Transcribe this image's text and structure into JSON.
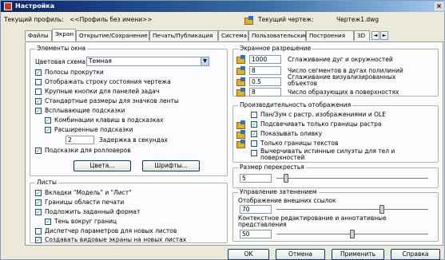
{
  "window": {
    "title": "Настройка"
  },
  "profile": {
    "current_profile_label": "Текущий профиль:",
    "current_profile_value": "<<Профиль без имени>>",
    "current_drawing_label": "Текущий чертеж:",
    "current_drawing_value": "Чертеж1.dwg"
  },
  "tabs": [
    "Файлы",
    "Экран",
    "Открытие/Сохранение",
    "Печать/Публикация",
    "Система",
    "Пользовательские",
    "Построения",
    "3D"
  ],
  "active_tab": "Экран",
  "window_elements": {
    "title": "Элементы окна",
    "color_scheme_label": "Цветовая схема:",
    "color_scheme_value": "Темная",
    "checkboxes": [
      {
        "label": "Полосы прокрутки",
        "checked": true
      },
      {
        "label": "Отображать строку состояния чертежа",
        "checked": false
      },
      {
        "label": "Крупные кнопки для панелей задач",
        "checked": false
      },
      {
        "label": "Стандартные размеры для значков ленты",
        "checked": true
      },
      {
        "label": "Всплывающие подсказки",
        "checked": true
      },
      {
        "label": "Комбинации клавиш в подсказках",
        "checked": true
      },
      {
        "label": "Расширенные подсказки",
        "checked": true
      }
    ],
    "delay_value": "2",
    "delay_label": "Задержка в секундах",
    "rollover_label": "Подсказки для ролловеров",
    "rollover_checked": true,
    "colors_button": "Цвета...",
    "fonts_button": "Шрифты..."
  },
  "layouts": {
    "title": "Листы",
    "checkboxes": [
      {
        "label": "Вкладки \"Модель\" и \"Лист\"",
        "checked": true
      },
      {
        "label": "Границы области печати",
        "checked": true
      },
      {
        "label": "Подложить заданный формат",
        "checked": true
      },
      {
        "label": "Тень вокруг границ",
        "checked": true
      },
      {
        "label": "Диспетчер параметров для новых листов",
        "checked": false
      },
      {
        "label": "Создавать видовые экраны на новых листах",
        "checked": true
      }
    ]
  },
  "display_resolution": {
    "title": "Экранное разрешение",
    "rows": [
      {
        "value": "1000",
        "label": "Сглаживание дуг и окружностей"
      },
      {
        "value": "8",
        "label": "Число сегментов в дугах полилиний"
      },
      {
        "value": "0.5",
        "label": "Сглаживание визуализированных объектов"
      },
      {
        "value": "8",
        "label": "Число образующих в поверхностях"
      }
    ]
  },
  "display_performance": {
    "title": "Производительность отображения",
    "checkboxes": [
      {
        "label": "Пан/Зум с растр. изображениями и OLE",
        "checked": false
      },
      {
        "label": "Подсвечивать только границы растра",
        "checked": true
      },
      {
        "label": "Показывать оливку",
        "checked": true
      },
      {
        "label": "Только границы текстов",
        "checked": false
      },
      {
        "label": "Вычерчивать истинные силуэты для тел и поверхностей",
        "checked": false
      }
    ]
  },
  "crosshair": {
    "title": "Размер перекрестья",
    "value": "5",
    "slider_fraction": 0.05
  },
  "fade_control": {
    "title": "Управление затенением",
    "xref_label": "Отображение внешних ссылок",
    "xref_value": "70",
    "xref_fraction": 0.7,
    "inplace_label": "Контекстное редактирование и аннотативные представления",
    "inplace_value": "50",
    "inplace_fraction": 0.5
  },
  "buttons": {
    "ok": "OK",
    "cancel": "Отмена",
    "apply": "Применить",
    "help": "Справка"
  }
}
